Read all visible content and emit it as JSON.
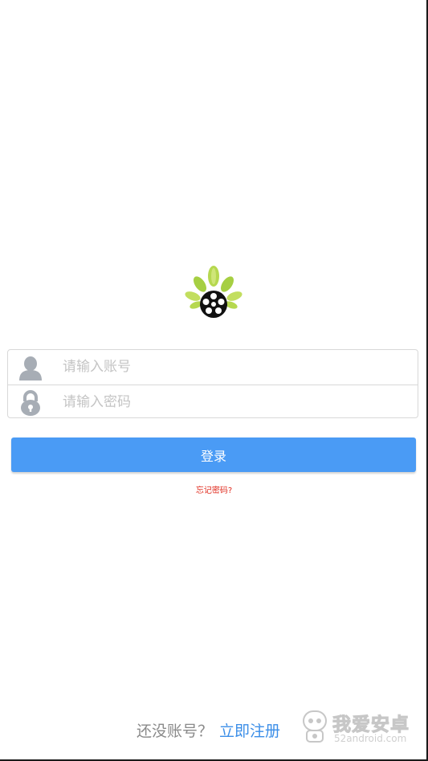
{
  "login": {
    "username_placeholder": "请输入账号",
    "password_placeholder": "请输入密码",
    "login_button_label": "登录",
    "forgot_password_label": "忘记密码?"
  },
  "register": {
    "prompt": "还没账号？",
    "link_label": "立即注册"
  },
  "watermark": {
    "name": "我爱安卓",
    "domain": "52android.com"
  },
  "icons": {
    "logo": "leaf-film-reel-logo",
    "username": "user-icon",
    "password": "lock-icon",
    "watermark": "android-robot-icon"
  },
  "colors": {
    "primary_button": "#4a9bf5",
    "forgot_link": "#e02b1e",
    "register_link": "#3b8ee8",
    "placeholder": "#c4c4c4",
    "leaf_green": "#a6cf42"
  }
}
